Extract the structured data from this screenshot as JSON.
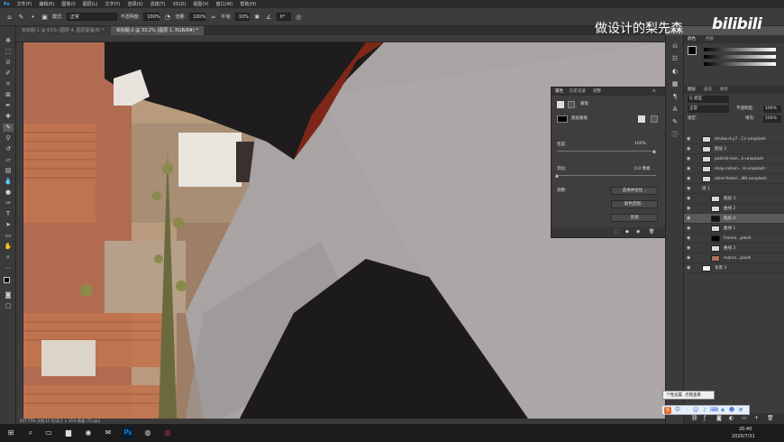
{
  "menubar": {
    "items": [
      "文件(F)",
      "编辑(E)",
      "图像(I)",
      "图层(L)",
      "文字(Y)",
      "选择(S)",
      "滤镜(T)",
      "3D(D)",
      "视图(V)",
      "窗口(W)",
      "帮助(H)"
    ]
  },
  "options": {
    "mode_label": "模式:",
    "mode_value": "正常",
    "opacity_label": "不透明度:",
    "opacity_value": "100%",
    "flow_label": "流量:",
    "flow_value": "100%",
    "smooth_label": "平滑:",
    "smooth_value": "10%",
    "angle_value": "0°"
  },
  "tabs": [
    {
      "label": "未标题-1 @ 63% (图层 4, 图层蒙版/8) *"
    },
    {
      "label": "未标题-2 @ 33.2% (图层 1, RGB/8#) *"
    }
  ],
  "status": {
    "text": "637.75%   文档:12 位/英寸 × 31% 数量 (72 ppi)"
  },
  "watermark": {
    "chinese": "做设计的梨先森",
    "bili": "bilibili"
  },
  "properties": {
    "tabs": [
      "属性",
      "历史记录",
      "调整"
    ],
    "header": "蒙版",
    "mask_label": "图层蒙版",
    "density_label": "密度:",
    "density_value": "100%",
    "feather_label": "羽化:",
    "feather_value": "0.0 像素",
    "adjust_label": "调整:",
    "btn_select": "选择并遮住...",
    "btn_color": "颜色范围...",
    "btn_invert": "反相"
  },
  "right": {
    "color_tabs": [
      "颜色",
      "色板"
    ],
    "layers_tabs": [
      "图层",
      "通道",
      "路径"
    ],
    "kind_value": "Q 类型",
    "blend_value": "正常",
    "opacity_label": "不透明度:",
    "opacity_value": "100%",
    "lock_label": "锁定:",
    "fill_label": "填充:",
    "fill_value": "100%",
    "layers": [
      {
        "name": "zhuba-d-y7...Cc-unsplash"
      },
      {
        "name": "图层 2"
      },
      {
        "name": "patrick-hen...k-unsplash"
      },
      {
        "name": "shay-cohen-...k-unsplash"
      },
      {
        "name": "aline-fedori...N0-unsplash"
      },
      {
        "name": "组 1"
      },
      {
        "name": "图层 3"
      },
      {
        "name": "曲线 2"
      },
      {
        "name": "图层 4"
      },
      {
        "name": "曲线 1"
      },
      {
        "name": "franco...plash"
      },
      {
        "name": "曲线 3"
      },
      {
        "name": "marco...plash"
      },
      {
        "name": "背景 3"
      }
    ]
  },
  "tooltip": {
    "text": "个性设置, 点我查看"
  },
  "taskbar": {
    "time": "20:40",
    "date": "2020/7/31"
  },
  "colors": {
    "shirt": "#a8a4a4",
    "dog": "#1c1a1a",
    "collar": "#8c2a1f",
    "roof": "#b86a4d",
    "sky": "#e8e0d8"
  }
}
